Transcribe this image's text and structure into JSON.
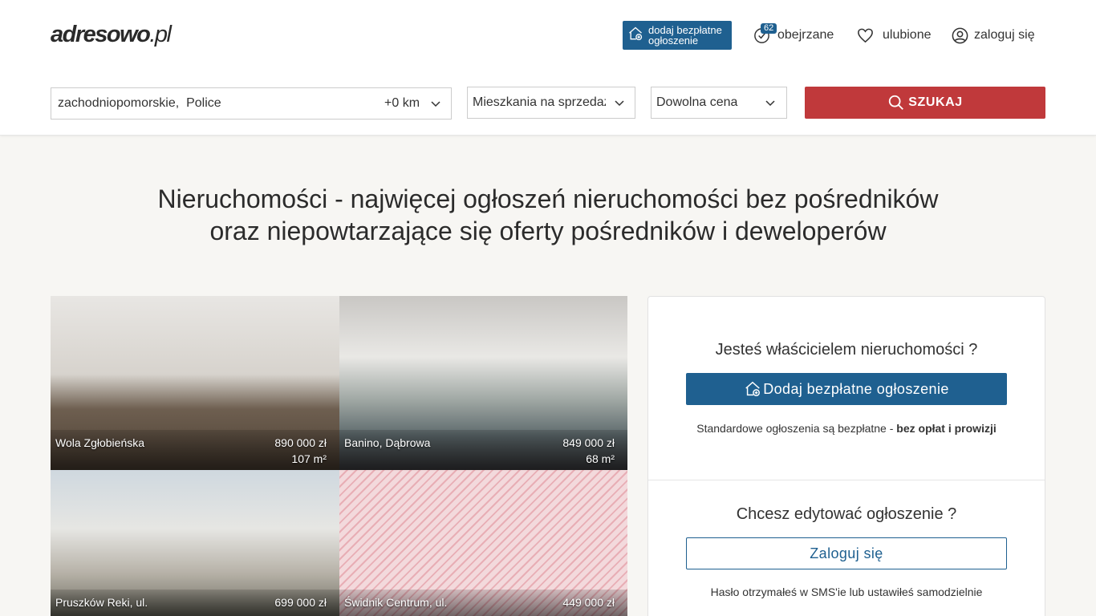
{
  "header": {
    "logo_main": "adresowo",
    "logo_tld": ".pl",
    "add_listing_label": "dodaj bezpłatne ogłoszenie",
    "watched": {
      "label": "obejrzane",
      "count": "62"
    },
    "favorites_label": "ulubione",
    "login_label": "zaloguj się"
  },
  "search": {
    "location_value": "zachodniopomorskie,  Police",
    "radius": "+0 km",
    "type_value": "Mieszkania na sprzedaż",
    "price_value": "Dowolna cena",
    "button_label": "SZUKAJ"
  },
  "headline": {
    "line1": "Nieruchomości - najwięcej ogłoszeń nieruchomości bez pośredników",
    "line2": "oraz niepowtarzające się oferty pośredników i deweloperów"
  },
  "listings": [
    {
      "location": "Wola Zgłobieńska",
      "price": "890 000 zł",
      "area": "107 m²"
    },
    {
      "location": "Banino, Dąbrowa",
      "price": "849 000 zł",
      "area": "68 m²"
    },
    {
      "location": "Pruszków Reki, ul.",
      "price": "699 000 zł",
      "area": ""
    },
    {
      "location": "Świdnik Centrum, ul.",
      "price": "449 000 zł",
      "area": ""
    }
  ],
  "owner_panel": {
    "question_owner": "Jesteś właścicielem nieruchomości ?",
    "add_button": "Dodaj bezpłatne ogłoszenie",
    "note_prefix": "Standardowe ogłoszenia są bezpłatne - ",
    "note_bold": "bez opłat i prowizji",
    "question_edit": "Chcesz edytować ogłoszenie ?",
    "login_button": "Zaloguj się",
    "note_password": "Hasło otrzymałeś w SMS'ie lub ustawiłeś samodzielnie"
  },
  "colors": {
    "brand_blue": "#1f6090",
    "search_red": "#c0393b"
  },
  "icons": [
    "house-plus-icon",
    "eye-check-icon",
    "heart-icon",
    "user-circle-icon",
    "chevron-down-icon",
    "search-icon"
  ]
}
